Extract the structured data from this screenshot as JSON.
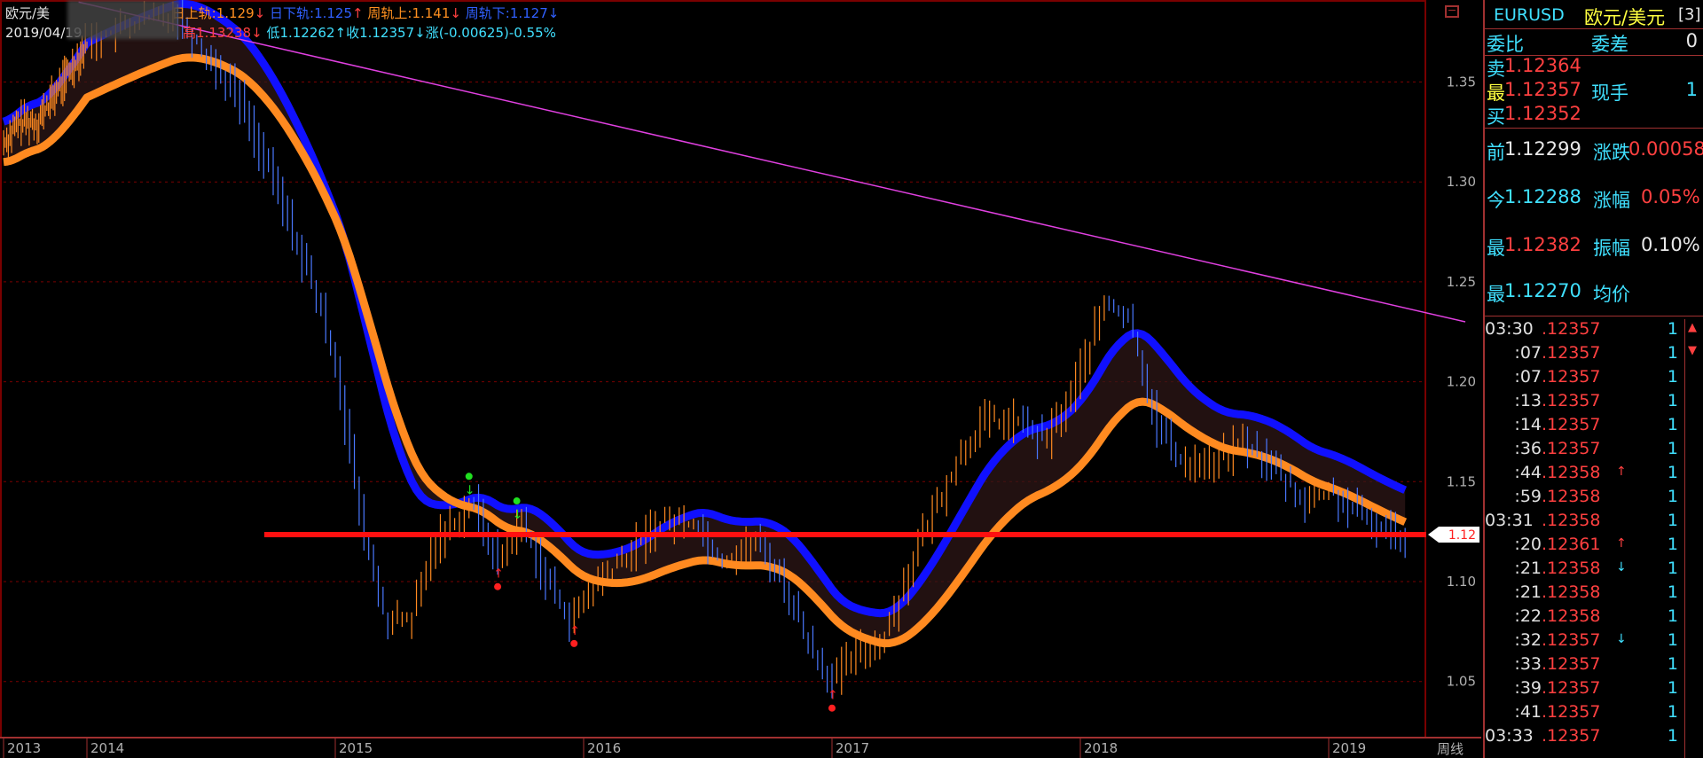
{
  "header": {
    "symbol_short": "欧元/美",
    "date": "2019/04/19",
    "day_upper_label": "日上轨:",
    "day_upper_value": "1.129",
    "day_lower_label": "日下轨:",
    "day_lower_value": "1.125",
    "week_upper_label": "周轨上:",
    "week_upper_value": "1.141",
    "week_lower_label": "周轨下:",
    "week_lower_value": "1.127",
    "high_label": "高",
    "high_value": "1.13238",
    "low_label": "低",
    "low_value": "1.12262",
    "close_label": "收",
    "close_value": "1.12357",
    "change_label": "涨",
    "change_value": "(-0.00625)-0.55%"
  },
  "chart_data": {
    "type": "line",
    "title": "",
    "period_label": "周线",
    "x_tick_labels": [
      "2013",
      "2014",
      "2015",
      "2016",
      "2017",
      "2018",
      "2019"
    ],
    "y_ticks": [
      1.05,
      1.1,
      1.15,
      1.2,
      1.25,
      1.3,
      1.35
    ],
    "ylim": [
      1.03,
      1.4
    ],
    "current_price_tag": "1.12",
    "horizontal_level": 1.1235,
    "trend_line": {
      "start": {
        "year": 2013.9,
        "value": 1.39
      },
      "end": {
        "year": 2019.55,
        "value": 1.23
      }
    },
    "series": [
      {
        "values_by_year": [
          [
            2013.0,
            1.32
          ],
          [
            2013.2,
            1.33
          ],
          [
            2013.4,
            1.33
          ],
          [
            2013.7,
            1.35
          ],
          [
            2014.0,
            1.37
          ],
          [
            2014.2,
            1.38
          ],
          [
            2014.35,
            1.385
          ],
          [
            2014.5,
            1.36
          ],
          [
            2014.6,
            1.345
          ],
          [
            2014.75,
            1.3
          ],
          [
            2014.9,
            1.25
          ],
          [
            2015.0,
            1.21
          ],
          [
            2015.1,
            1.13
          ],
          [
            2015.2,
            1.08
          ],
          [
            2015.3,
            1.08
          ],
          [
            2015.4,
            1.12
          ],
          [
            2015.55,
            1.14
          ],
          [
            2015.65,
            1.11
          ],
          [
            2015.75,
            1.13
          ],
          [
            2015.85,
            1.1
          ],
          [
            2015.95,
            1.08
          ],
          [
            2016.05,
            1.1
          ],
          [
            2016.15,
            1.11
          ],
          [
            2016.3,
            1.13
          ],
          [
            2016.45,
            1.13
          ],
          [
            2016.55,
            1.11
          ],
          [
            2016.7,
            1.12
          ],
          [
            2016.8,
            1.1
          ],
          [
            2016.9,
            1.07
          ],
          [
            2017.0,
            1.05
          ],
          [
            2017.1,
            1.065
          ],
          [
            2017.2,
            1.07
          ],
          [
            2017.35,
            1.12
          ],
          [
            2017.5,
            1.16
          ],
          [
            2017.6,
            1.18
          ],
          [
            2017.75,
            1.18
          ],
          [
            2017.85,
            1.17
          ],
          [
            2017.95,
            1.19
          ],
          [
            2018.1,
            1.24
          ],
          [
            2018.2,
            1.23
          ],
          [
            2018.3,
            1.18
          ],
          [
            2018.4,
            1.16
          ],
          [
            2018.55,
            1.16
          ],
          [
            2018.65,
            1.17
          ],
          [
            2018.75,
            1.16
          ],
          [
            2018.9,
            1.14
          ],
          [
            2019.0,
            1.145
          ],
          [
            2019.15,
            1.13
          ],
          [
            2019.3,
            1.123
          ]
        ]
      }
    ]
  },
  "quote_panel": {
    "symbol": "EURUSD",
    "name": "欧元/美元",
    "index_suffix": "[3]",
    "ratio_label": "委比",
    "diff_label": "委差",
    "diff_value": "0",
    "sell_label": "卖",
    "sell_value": "1.12364",
    "last_label": "最",
    "last_value": "1.12357",
    "hand_label": "现手",
    "hand_value": "1",
    "buy_label": "买",
    "buy_value": "1.12352",
    "prev_label": "前",
    "prev_value": "1.12299",
    "chg_label": "涨跌",
    "chg_value": "0.00058",
    "open_label": "今",
    "open_value": "1.12288",
    "pct_label": "涨幅",
    "pct_value": "0.05%",
    "high_label": "最",
    "high_value": "1.12382",
    "amp_label": "振幅",
    "amp_value": "0.10%",
    "low_label": "最",
    "low_value": "1.12270",
    "avg_label": "均价"
  },
  "ticks": [
    {
      "time": "03:30",
      "price": ".12357",
      "arrow": "",
      "qty": "1"
    },
    {
      "time": ":07",
      "price": ".12357",
      "arrow": "",
      "qty": "1"
    },
    {
      "time": ":07",
      "price": ".12357",
      "arrow": "",
      "qty": "1"
    },
    {
      "time": ":13",
      "price": ".12357",
      "arrow": "",
      "qty": "1"
    },
    {
      "time": ":14",
      "price": ".12357",
      "arrow": "",
      "qty": "1"
    },
    {
      "time": ":36",
      "price": ".12357",
      "arrow": "",
      "qty": "1"
    },
    {
      "time": ":44",
      "price": ".12358",
      "arrow": "↑",
      "qty": "1"
    },
    {
      "time": ":59",
      "price": ".12358",
      "arrow": "",
      "qty": "1"
    },
    {
      "time": "03:31",
      "price": ".12358",
      "arrow": "",
      "qty": "1"
    },
    {
      "time": ":20",
      "price": ".12361",
      "arrow": "↑",
      "qty": "1"
    },
    {
      "time": ":21",
      "price": ".12358",
      "arrow": "↓",
      "qty": "1"
    },
    {
      "time": ":21",
      "price": ".12358",
      "arrow": "",
      "qty": "1"
    },
    {
      "time": ":22",
      "price": ".12358",
      "arrow": "",
      "qty": "1"
    },
    {
      "time": ":32",
      "price": ".12357",
      "arrow": "↓",
      "qty": "1"
    },
    {
      "time": ":33",
      "price": ".12357",
      "arrow": "",
      "qty": "1"
    },
    {
      "time": ":39",
      "price": ".12357",
      "arrow": "",
      "qty": "1"
    },
    {
      "time": ":41",
      "price": ".12357",
      "arrow": "",
      "qty": "1"
    },
    {
      "time": "03:33",
      "price": ".12357",
      "arrow": "",
      "qty": "1"
    }
  ],
  "colors": {
    "upper_band": "#1010ff",
    "lower_band": "#ff8a20",
    "trend_line": "#e040e0",
    "level_line": "#ff1010",
    "grid": "#7a0000",
    "up_signal": "#20e020",
    "down_signal": "#ff2020"
  },
  "icons": [
    "window-restore-icon",
    "scroll-up-icon",
    "scroll-down-icon",
    "arrow-up-icon",
    "arrow-down-icon"
  ]
}
